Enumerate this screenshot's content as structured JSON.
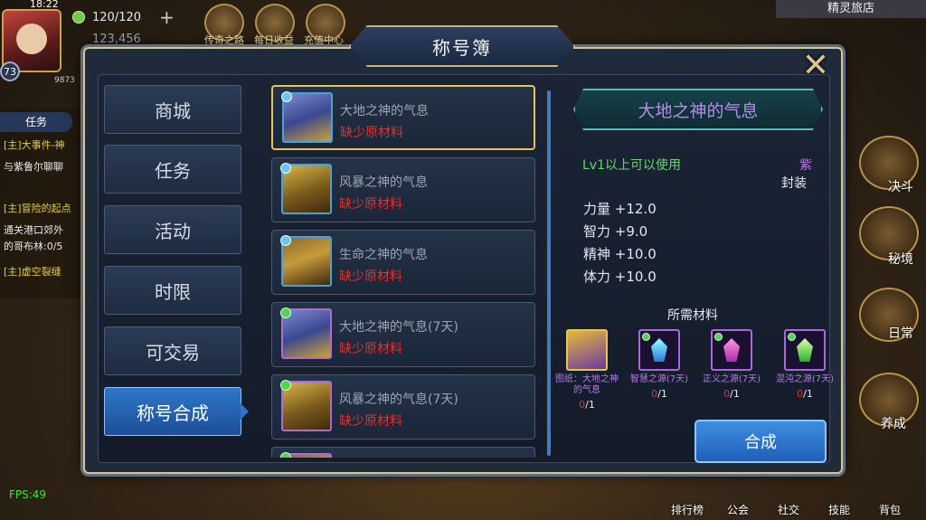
{
  "hud": {
    "clock": "18:22",
    "stamina": "120/120",
    "gold": "123,456",
    "level": "73",
    "exp_hint": "9873",
    "top_icons": [
      "传奇之路",
      "每日收益",
      "充值中心"
    ],
    "inn_title": "精灵旅店",
    "quest_tab": "任务",
    "quest_lines": [
      {
        "text": "[主]大事件-神",
        "color": "#e0d040"
      },
      {
        "text": "与紫鲁尔聊聊",
        "color": "#e8e8e8"
      },
      {
        "text": "[主]冒险的起点",
        "color": "#e0d040"
      },
      {
        "text": "通关港口郊外",
        "color": "#e8e8e8"
      },
      {
        "text": "的哥布林:0/5",
        "color": "#e8e8e8"
      },
      {
        "text": "[主]虚空裂缝",
        "color": "#e0d040"
      }
    ],
    "right_menu": [
      "决斗",
      "秘境",
      "日常",
      "养成"
    ],
    "bottom_bar": [
      "排行榜",
      "公会",
      "社交",
      "技能",
      "背包"
    ],
    "fps": "FPS:49"
  },
  "dialog": {
    "title": "称号簿",
    "close_icon": "close-x-icon",
    "categories": [
      {
        "label": "商城",
        "active": false
      },
      {
        "label": "任务",
        "active": false
      },
      {
        "label": "活动",
        "active": false
      },
      {
        "label": "时限",
        "active": false
      },
      {
        "label": "可交易",
        "active": false
      },
      {
        "label": "称号合成",
        "active": true
      }
    ],
    "list": [
      {
        "name": "大地之神的气息",
        "status": "缺少原材料",
        "selected": true
      },
      {
        "name": "风暴之神的气息",
        "status": "缺少原材料",
        "selected": false
      },
      {
        "name": "生命之神的气息",
        "status": "缺少原材料",
        "selected": false
      },
      {
        "name": "大地之神的气息(7天)",
        "status": "缺少原材料",
        "selected": false
      },
      {
        "name": "风暴之神的气息(7天)",
        "status": "缺少原材料",
        "selected": false
      }
    ],
    "detail": {
      "title": "大地之神的气息",
      "required_level": "Lv1以上可以使用",
      "quality": "紫",
      "bind_type": "封装",
      "stats": [
        "力量 +12.0",
        "智力 +9.0",
        "精神 +10.0",
        "体力 +10.0"
      ],
      "materials_header": "所需材料",
      "materials": [
        {
          "name": "图纸：大地之神的气息",
          "have": "0",
          "need": "/1",
          "icon": "blueprint-icon"
        },
        {
          "name": "智慧之源(7天)",
          "have": "0",
          "need": "/1",
          "icon": "blue-gem-icon"
        },
        {
          "name": "正义之源(7天)",
          "have": "0",
          "need": "/1",
          "icon": "pink-gem-icon"
        },
        {
          "name": "混沌之源(7天)",
          "have": "0",
          "need": "/1",
          "icon": "green-gem-icon"
        }
      ],
      "synth_button": "合成"
    }
  },
  "colors": {
    "missing": "#e0322e",
    "purple_quality": "#c070f0",
    "level_req": "#62d86a",
    "active_tab": "#2f76c9",
    "selected_border": "#e6c45a"
  }
}
